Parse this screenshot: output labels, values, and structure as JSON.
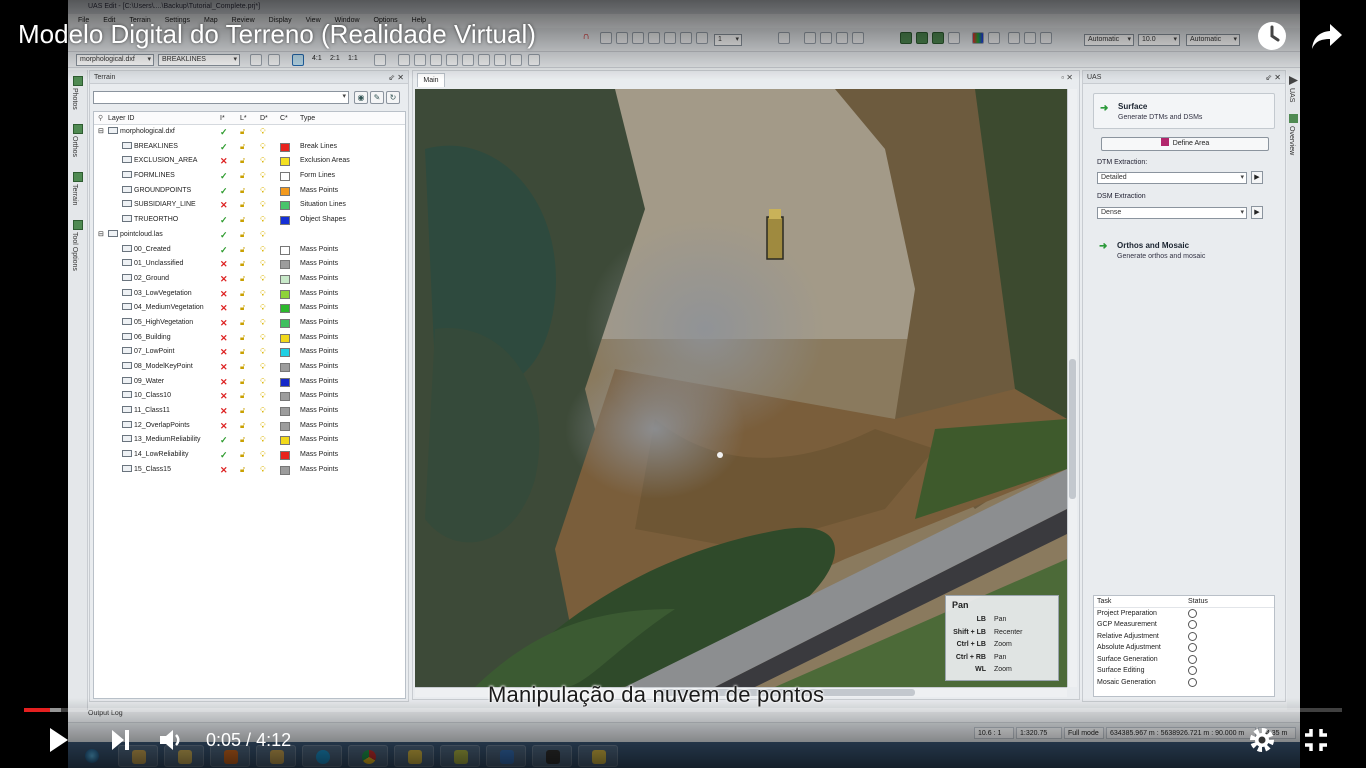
{
  "video": {
    "title": "Modelo Digital do Terreno (Realidade Virtual)",
    "caption": "Manipulação da nuvem de pontos",
    "time_current": "0:05",
    "time_separator": " / ",
    "time_total": "4:12",
    "progress_fraction": 0.0198,
    "buffer_fraction": 0.028,
    "accent_color": "#e52020"
  },
  "app": {
    "window_title": "UAS Edit - [C:\\Users\\....\\Backup\\Tutorial_Complete.prj*]",
    "menu": [
      "File",
      "Edit",
      "Terrain",
      "Settings",
      "Map",
      "Review",
      "Display",
      "View",
      "Window",
      "Options",
      "Help"
    ],
    "layer_combo": "morphological.dxf",
    "sublayer_combo": "BREAKLINES",
    "toolbar_combo1": "Automatic",
    "toolbar_combo2": "10.0",
    "toolbar_combo3": "Automatic",
    "toolbar_field": "1",
    "scale_labels": [
      "4:1",
      "2:1",
      "1:1"
    ]
  },
  "sidetabs": [
    "Photos",
    "Orthos",
    "Terrain",
    "Tool Options"
  ],
  "right_tabs": [
    "UAS",
    "Overview"
  ],
  "terrain_panel": {
    "title": "Terrain",
    "controls": "⇙ ✕",
    "columns": {
      "layer": "Layer ID",
      "visible": "I*",
      "locked": "L*",
      "display": "D*",
      "color": "C*",
      "type": "Type"
    },
    "groups": [
      {
        "name": "morphological.dxf",
        "layers": [
          {
            "name": "BREAKLINES",
            "visible": true,
            "color": "#e8231d",
            "type": "Break Lines"
          },
          {
            "name": "EXCLUSION_AREA",
            "visible": false,
            "color": "#f4e021",
            "type": "Exclusion Areas"
          },
          {
            "name": "FORMLINES",
            "visible": true,
            "color": "#ffffff",
            "type": "Form Lines"
          },
          {
            "name": "GROUNDPOINTS",
            "visible": true,
            "color": "#f39a1e",
            "type": "Mass Points"
          },
          {
            "name": "SUBSIDIARY_LINE",
            "visible": false,
            "color": "#49c46b",
            "type": "Situation Lines"
          },
          {
            "name": "TRUEORTHO",
            "visible": true,
            "color": "#1530d6",
            "type": "Object Shapes"
          }
        ]
      },
      {
        "name": "pointcloud.las",
        "layers": [
          {
            "name": "00_Created",
            "visible": true,
            "color": "#ffffff",
            "type": "Mass Points"
          },
          {
            "name": "01_Unclassified",
            "visible": false,
            "color": "#9c9c9c",
            "type": "Mass Points"
          },
          {
            "name": "02_Ground",
            "visible": false,
            "color": "#c8e9c9",
            "type": "Mass Points"
          },
          {
            "name": "03_LowVegetation",
            "visible": false,
            "color": "#8fd33a",
            "type": "Mass Points"
          },
          {
            "name": "04_MediumVegetation",
            "visible": false,
            "color": "#2cb82c",
            "type": "Mass Points"
          },
          {
            "name": "05_HighVegetation",
            "visible": false,
            "color": "#3fbf5f",
            "type": "Mass Points"
          },
          {
            "name": "06_Building",
            "visible": false,
            "color": "#f2d91b",
            "type": "Mass Points"
          },
          {
            "name": "07_LowPoint",
            "visible": false,
            "color": "#1fd0e4",
            "type": "Mass Points"
          },
          {
            "name": "08_ModelKeyPoint",
            "visible": false,
            "color": "#9c9c9c",
            "type": "Mass Points"
          },
          {
            "name": "09_Water",
            "visible": false,
            "color": "#1428c8",
            "type": "Mass Points"
          },
          {
            "name": "10_Class10",
            "visible": false,
            "color": "#9c9c9c",
            "type": "Mass Points"
          },
          {
            "name": "11_Class11",
            "visible": false,
            "color": "#9c9c9c",
            "type": "Mass Points"
          },
          {
            "name": "12_OverlapPoints",
            "visible": false,
            "color": "#9c9c9c",
            "type": "Mass Points"
          },
          {
            "name": "13_MediumReliability",
            "visible": true,
            "color": "#f2d91b",
            "type": "Mass Points"
          },
          {
            "name": "14_LowReliability",
            "visible": true,
            "color": "#e8231d",
            "type": "Mass Points"
          },
          {
            "name": "15_Class15",
            "visible": false,
            "color": "#9c9c9c",
            "type": "Mass Points"
          }
        ]
      }
    ]
  },
  "main_view": {
    "tab": "Main",
    "controls": "▫ ✕"
  },
  "pan_help": {
    "title": "Pan",
    "rows": [
      {
        "keys": "LB",
        "action": "Pan"
      },
      {
        "keys": "Shift + LB",
        "action": "Recenter"
      },
      {
        "keys": "Ctrl + LB",
        "action": "Zoom"
      },
      {
        "keys": "Ctrl + RB",
        "action": "Pan"
      },
      {
        "keys": "WL",
        "action": "Zoom"
      }
    ]
  },
  "uas_panel": {
    "title": "UAS",
    "controls": "⇙ ✕",
    "surface": {
      "title": "Surface",
      "subtitle": "Generate DTMs and DSMs"
    },
    "define_area": "Define Area",
    "dtm_label": "DTM Extraction:",
    "dtm_value": "Detailed",
    "dsm_label": "DSM Extraction",
    "dsm_value": "Dense",
    "orthos": {
      "title": "Orthos and Mosaic",
      "subtitle": "Generate orthos and mosaic"
    },
    "tasks_header": {
      "task": "Task",
      "status": "Status"
    },
    "tasks": [
      "Project Preparation",
      "GCP Measurement",
      "Relative Adjustment",
      "Absolute Adjustment",
      "Surface Generation",
      "Surface Editing",
      "Mosaic Generation"
    ]
  },
  "statusbar": {
    "output_log": "Output Log",
    "zoom": "10.6 : 1",
    "scale": "1:320.75",
    "mode": "Full mode",
    "coords": "634385.967 m : 5638926.721 m : 90.000 m",
    "extra": "44.35 m"
  }
}
